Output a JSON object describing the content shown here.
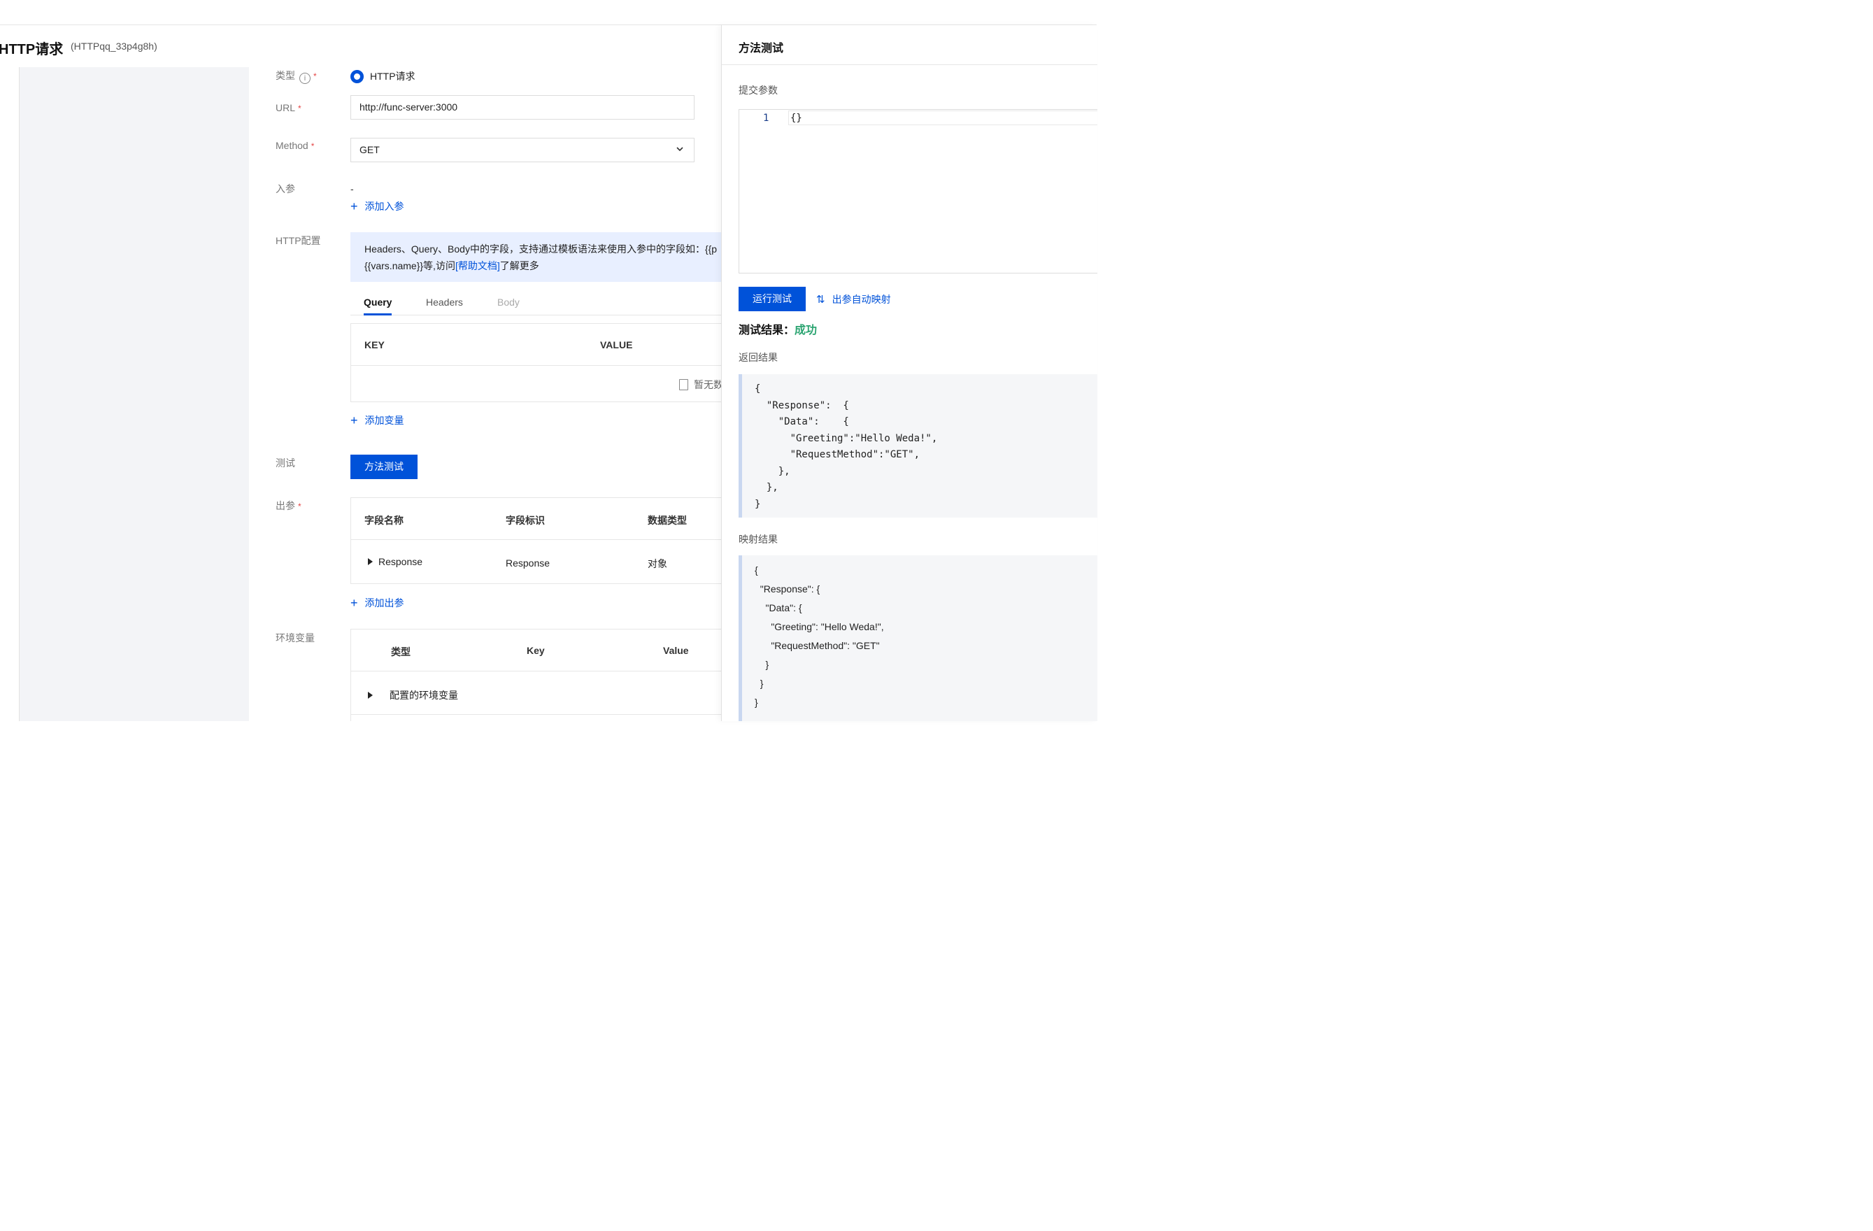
{
  "header": {
    "title": "HTTP请求",
    "id": "(HTTPqq_33p4g8h)"
  },
  "form": {
    "type": {
      "label": "类型",
      "info_icon": "i",
      "option": "HTTP请求"
    },
    "url": {
      "label": "URL",
      "value": "http://func-server:3000"
    },
    "method": {
      "label": "Method",
      "value": "GET"
    },
    "inparams": {
      "label": "入参",
      "value": "-",
      "add_label": "添加入参"
    },
    "http_config": {
      "label": "HTTP配置",
      "info_line1": "Headers、Query、Body中的字段，支持通过模板语法来使用入参中的字段如：{{p",
      "info_line2_prefix": "{{vars.name}}等,访问",
      "info_link": "[帮助文档]",
      "info_line2_suffix": "了解更多",
      "tabs": [
        "Query",
        "Headers",
        "Body"
      ],
      "table": {
        "col_key": "KEY",
        "col_value": "VALUE",
        "empty": "暂无数"
      },
      "add_label": "添加变量"
    },
    "test": {
      "label": "测试",
      "button": "方法测试"
    },
    "outparams": {
      "label": "出参",
      "columns": [
        "字段名称",
        "字段标识",
        "数据类型"
      ],
      "rows": [
        {
          "name": "Response",
          "id": "Response",
          "type": "对象"
        }
      ],
      "add_label": "添加出参"
    },
    "env": {
      "label": "环境变量",
      "columns": [
        "类型",
        "Key",
        "Value"
      ],
      "rows": [
        {
          "name": "配置的环境变量"
        }
      ]
    }
  },
  "panel": {
    "title": "方法测试",
    "submit_label": "提交参数",
    "editor": {
      "line_number": "1",
      "code": "{}"
    },
    "run_button": "运行测试",
    "auto_map": "出参自动映射",
    "result_label": "测试结果：",
    "result_value": "成功",
    "return_label": "返回结果",
    "return_code": "{\n  \"Response\":  {\n    \"Data\":    {\n      \"Greeting\":\"Hello Weda!\",\n      \"RequestMethod\":\"GET\",\n    },\n  },\n}",
    "map_label": "映射结果",
    "map_code": "{\n  \"Response\": {\n    \"Data\": {\n      \"Greeting\": \"Hello Weda!\",\n      \"RequestMethod\": \"GET\"\n    }\n  }\n}"
  },
  "colors": {
    "primary": "#0052d9",
    "success": "#2ba471",
    "required": "#e54545",
    "info_bg": "#e8efff"
  }
}
